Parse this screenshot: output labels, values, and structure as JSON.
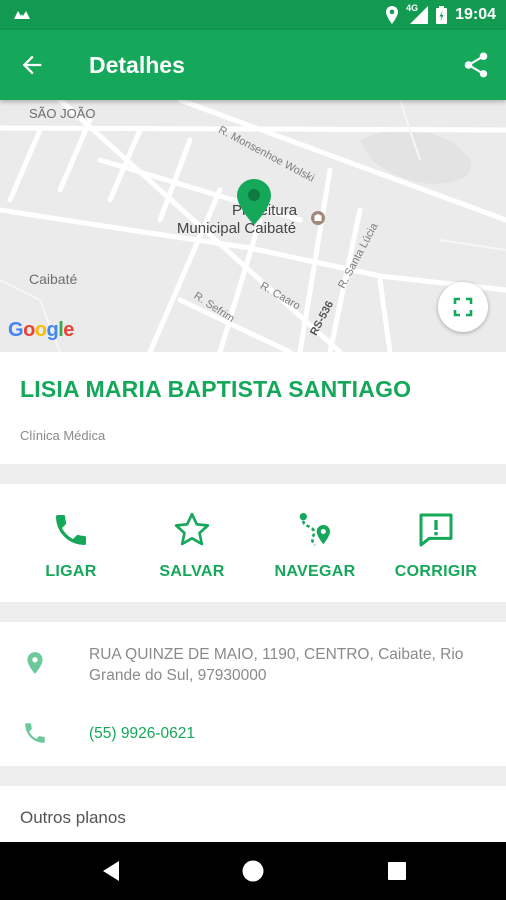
{
  "status_bar": {
    "time": "19:04",
    "network": "4G",
    "icons": [
      "notification-icon",
      "location-icon",
      "signal-icon",
      "battery-icon"
    ]
  },
  "app_bar": {
    "title": "Detalhes",
    "back_icon": "arrow-left-icon",
    "share_icon": "share-icon"
  },
  "map": {
    "labels": {
      "neighborhood": "SÃO JOÃO",
      "city": "Caibaté",
      "road_monsenhor": "R. Monsenhoe Wolski",
      "road_santa_lucia": "R. Santa Lúcia",
      "road_caaro": "R. Caaro",
      "road_sefrim": "R. Sefrim",
      "road_rs": "RS-536",
      "poi_line1": "Prefeitura",
      "poi_line2": "Municipal Caibaté"
    },
    "logo": "Google",
    "expand_icon": "fullscreen-icon"
  },
  "place": {
    "name": "LISIA MARIA BAPTISTA SANTIAGO",
    "category": "Clínica Médica"
  },
  "actions": [
    {
      "label": "LIGAR",
      "icon": "phone-icon"
    },
    {
      "label": "SALVAR",
      "icon": "star-icon"
    },
    {
      "label": "NAVEGAR",
      "icon": "route-icon"
    },
    {
      "label": "CORRIGIR",
      "icon": "feedback-icon"
    }
  ],
  "info": {
    "address": "RUA QUINZE DE MAIO, 1190, CENTRO, Caibate, Rio Grande do Sul, 97930000",
    "phone": "(55) 9926-0621"
  },
  "other": {
    "heading": "Outros planos"
  },
  "colors": {
    "primary": "#15a85a",
    "primary_dark": "#129a51",
    "icon_light": "#6cc99a",
    "text_muted": "#8a8a8a"
  }
}
